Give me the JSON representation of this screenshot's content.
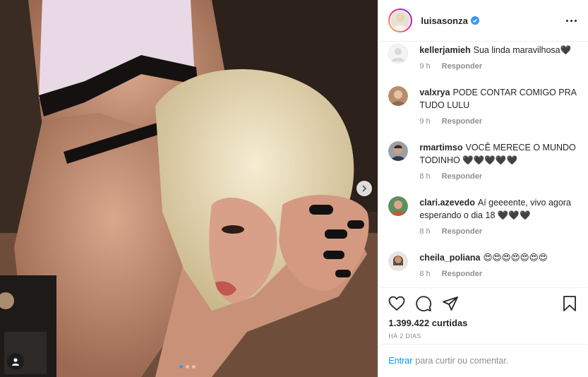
{
  "header": {
    "username": "luisasonza",
    "verified": true
  },
  "comments": [
    {
      "user": "kellerjamieh",
      "text": "Sua linda maravilhosa🖤",
      "time": "9 h",
      "reply": "Responder",
      "avatar_color": "#dcdcdc"
    },
    {
      "user": "valxrya",
      "text": "PODE CONTAR COMIGO PRA TUDO LULU",
      "time": "9 h",
      "reply": "Responder",
      "avatar_color": "#b88f6a"
    },
    {
      "user": "rmartimso",
      "text": "VOCÊ MERECE O MUNDO TODINHO 🖤🖤🖤🖤🖤",
      "time": "8 h",
      "reply": "Responder",
      "avatar_color": "#6b5a4a"
    },
    {
      "user": "clari.azevedo",
      "text": "Aí geeeente, vivo agora esperando o dia 18 🖤🖤🖤",
      "time": "8 h",
      "reply": "Responder",
      "avatar_color": "#5f8f5a"
    },
    {
      "user": "cheila_poliana",
      "text": "😍😍😍😍😍😍😍",
      "time": "8 h",
      "reply": "Responder",
      "avatar_color": "#8a6d5b"
    }
  ],
  "stats": {
    "likes": "1.399.422 curtidas",
    "time_ago": "HÁ 2 DIAS"
  },
  "login_prompt": {
    "link": "Entrar",
    "text": "para curtir ou comentar."
  },
  "carousel": {
    "slides": 3,
    "active": 1
  }
}
